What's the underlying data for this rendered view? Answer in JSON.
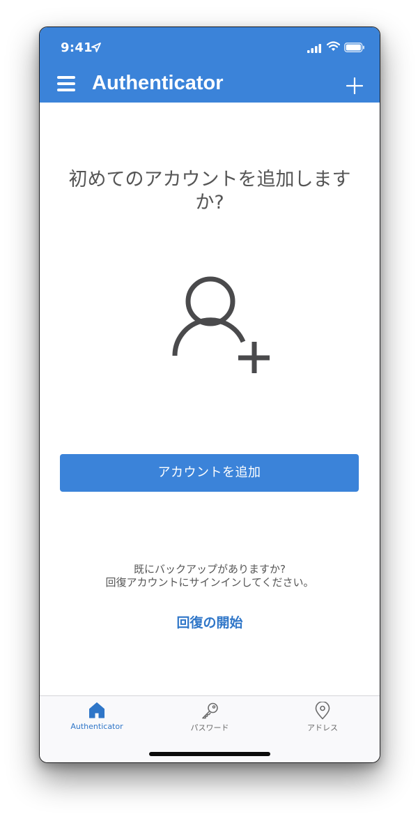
{
  "status_bar": {
    "time": "9:41",
    "icons": [
      "location-arrow-icon",
      "cellular-signal-icon",
      "wifi-icon",
      "battery-icon"
    ]
  },
  "header": {
    "title": "Authenticator",
    "menu_icon": "hamburger-menu-icon",
    "add_icon": "plus-icon",
    "background_color": "#3b83d9"
  },
  "main": {
    "prompt": "初めてのアカウントを追加しますか?",
    "illustration_icon": "person-add-icon",
    "add_account_button": "アカウントを追加",
    "restore_line1": "既にバックアップがありますか?",
    "restore_line2": "回復アカウントにサインインしてください。",
    "restore_link": "回復の開始"
  },
  "tabbar": {
    "tabs": [
      {
        "label": "Authenticator",
        "icon": "home-icon",
        "active": true
      },
      {
        "label": "パスワード",
        "icon": "key-icon",
        "active": false
      },
      {
        "label": "アドレス",
        "icon": "map-pin-icon",
        "active": false
      }
    ]
  },
  "colors": {
    "accent": "#3b83d9",
    "link": "#2f76c8",
    "text": "#555555"
  }
}
